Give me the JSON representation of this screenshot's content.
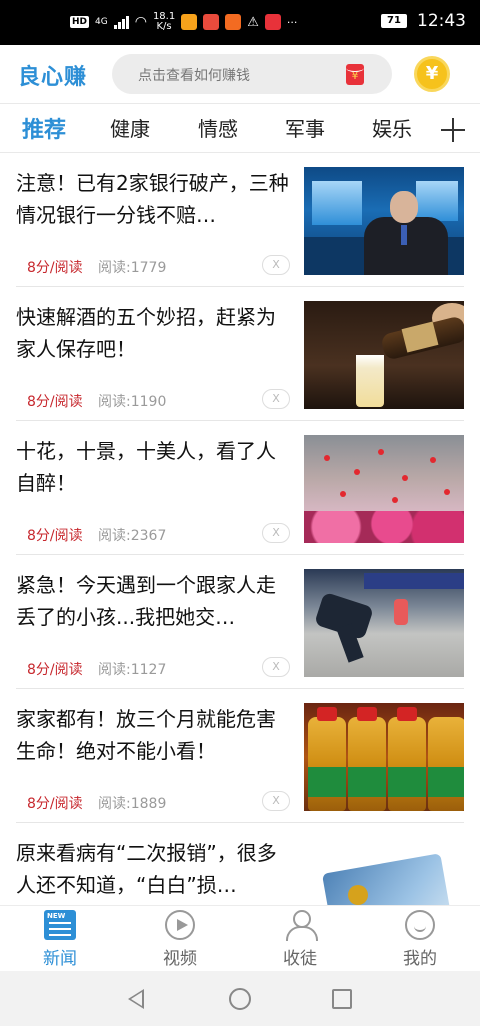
{
  "status_bar": {
    "network": "4G",
    "hd": "HD",
    "speed_top": "18.1",
    "speed_bottom": "K/s",
    "battery": "71",
    "time": "12:43",
    "more": "···"
  },
  "header": {
    "logo": "良心赚",
    "search_placeholder": "点击查看如何赚钱",
    "redpacket_symbol": "¥",
    "coin_symbol": "¥"
  },
  "tabs": [
    {
      "label": "推荐",
      "active": true
    },
    {
      "label": "健康"
    },
    {
      "label": "情感"
    },
    {
      "label": "军事"
    },
    {
      "label": "娱乐"
    }
  ],
  "articles": [
    {
      "title": "注意！已有2家银行破产，三种情况银行一分钱不赔…",
      "reward": "8分/阅读",
      "reads": "阅读:1779",
      "thumb": "news-anchor"
    },
    {
      "title": "快速解酒的五个妙招，赶紧为家人保存吧！",
      "reward": "8分/阅读",
      "reads": "阅读:1190",
      "thumb": "beer-pour"
    },
    {
      "title": "十花，十景，十美人，看了人自醉！",
      "reward": "8分/阅读",
      "reads": "阅读:2367",
      "thumb": "flowers"
    },
    {
      "title": "紧急！今天遇到一个跟家人走丢了的小孩...我把她交…",
      "reward": "8分/阅读",
      "reads": "阅读:1127",
      "thumb": "street-child"
    },
    {
      "title": "家家都有！放三个月就能危害生命！绝对不能小看！",
      "reward": "8分/阅读",
      "reads": "阅读:1889",
      "thumb": "oil-bottles"
    },
    {
      "title": "原来看病有“二次报销”，很多人还不知道，“白白”损…",
      "reward": "",
      "reads": "",
      "thumb": "card"
    }
  ],
  "dismiss_label": "X",
  "bottom_nav": [
    {
      "label": "新闻",
      "icon": "news-icon",
      "active": true
    },
    {
      "label": "视频",
      "icon": "video-play-icon"
    },
    {
      "label": "收徒",
      "icon": "people-icon"
    },
    {
      "label": "我的",
      "icon": "smile-face-icon"
    }
  ],
  "news_icon_text": "NEW",
  "colors": {
    "accent": "#2d8fd6",
    "reward": "#c7282e",
    "coin": "#f6c21c",
    "redpacket": "#e8323a"
  }
}
